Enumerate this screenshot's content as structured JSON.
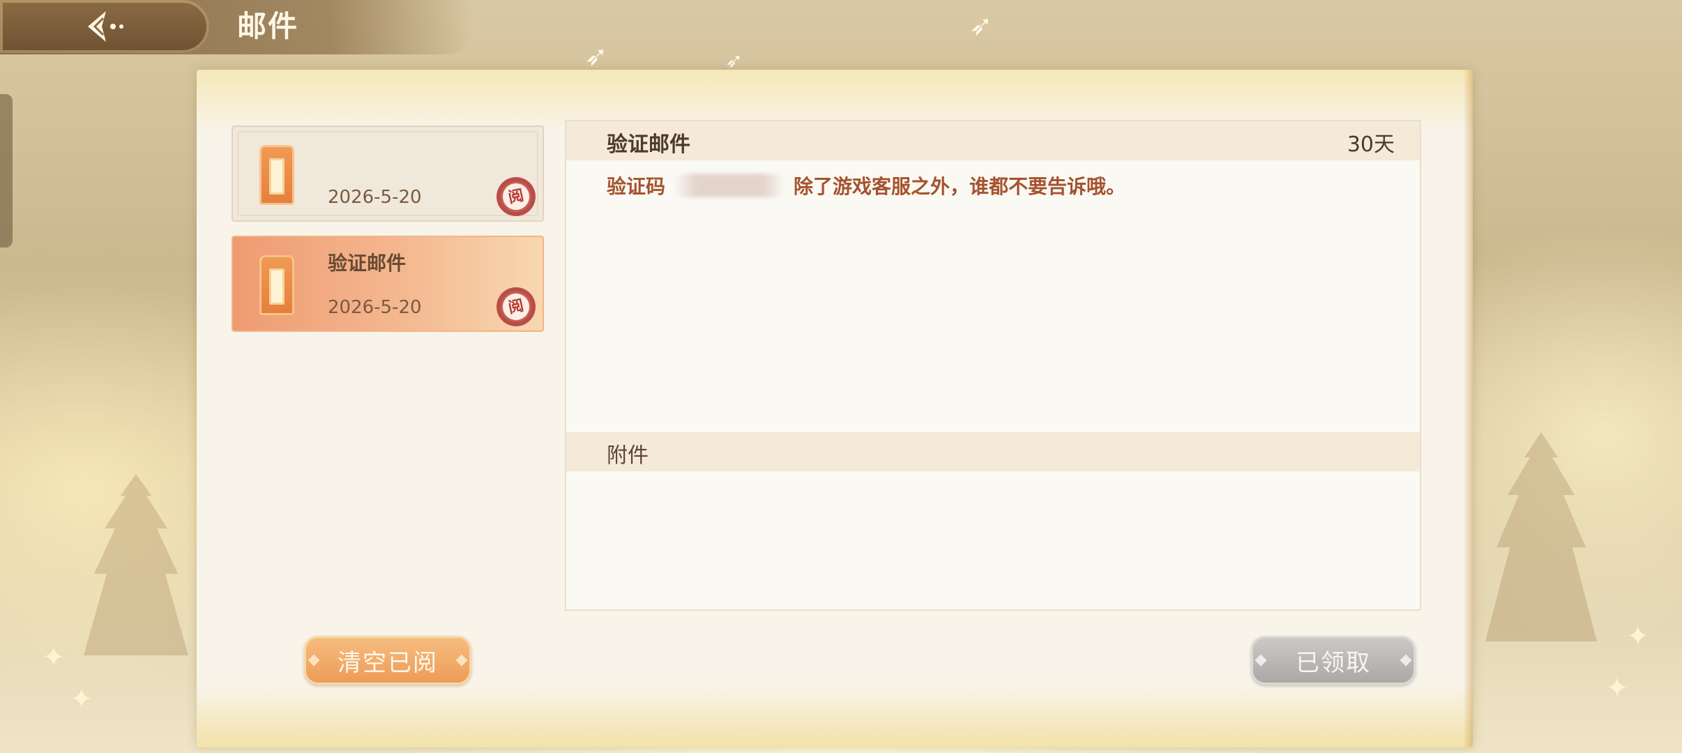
{
  "header": {
    "title": "邮件"
  },
  "mail_list": [
    {
      "title": "",
      "date": "2026-5-20",
      "read_seal": "阅",
      "selected": false
    },
    {
      "title": "验证邮件",
      "date": "2026-5-20",
      "read_seal": "阅",
      "selected": true
    }
  ],
  "detail": {
    "title": "验证邮件",
    "expiry": "30天",
    "body_prefix": "验证码",
    "body_suffix": "除了游戏客服之外，谁都不要告诉哦。",
    "attachments_label": "附件"
  },
  "buttons": {
    "clear_read": "清空已阅",
    "claimed": "已领取"
  },
  "colors": {
    "accent_orange": "#ed9a55",
    "body_text": "#a4532e",
    "panel_bg": "#f8f4ea",
    "disabled_gray": "#a9a7a4"
  }
}
